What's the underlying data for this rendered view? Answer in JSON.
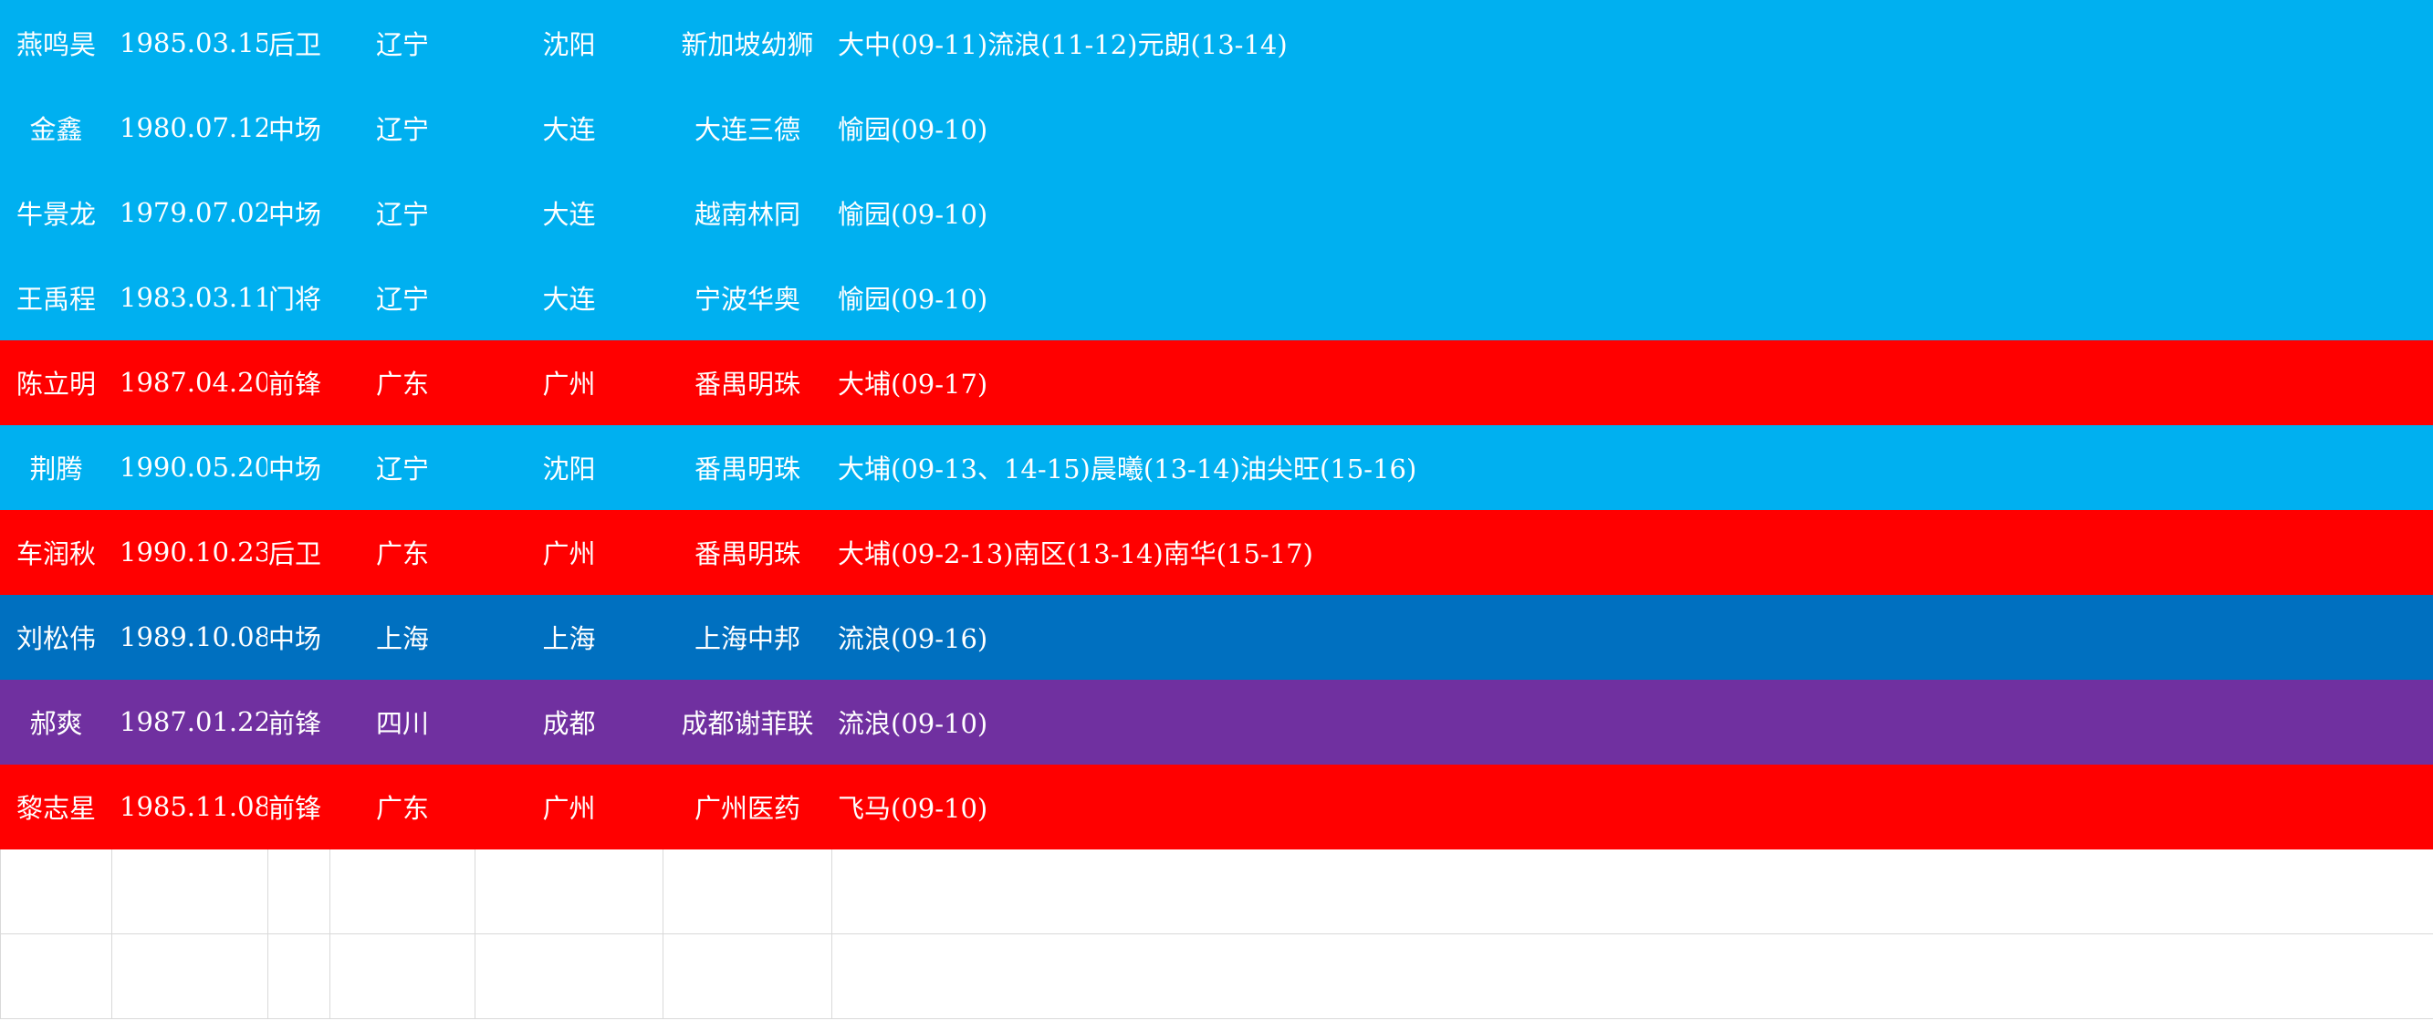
{
  "colors": {
    "liaoning": "#00b0f0",
    "guangdong": "#ff0000",
    "shanghai": "#0070c0",
    "sichuan": "#7030a0",
    "text": "#ffffff",
    "grid": "#d9d9d9"
  },
  "rows": [
    {
      "name": "燕鸣昊",
      "birth": "1985.03.15",
      "position": "后卫",
      "province": "辽宁",
      "city": "沈阳",
      "club": "新加坡幼狮",
      "history": "大中(09-11)流浪(11-12)元朗(13-14)",
      "color": "#00b0f0"
    },
    {
      "name": "金鑫",
      "birth": "1980.07.12",
      "position": "中场",
      "province": "辽宁",
      "city": "大连",
      "club": "大连三德",
      "history": "愉园(09-10)",
      "color": "#00b0f0"
    },
    {
      "name": "牛景龙",
      "birth": "1979.07.02",
      "position": "中场",
      "province": "辽宁",
      "city": "大连",
      "club": "越南林同",
      "history": "愉园(09-10)",
      "color": "#00b0f0"
    },
    {
      "name": "王禹程",
      "birth": "1983.03.11",
      "position": "门将",
      "province": "辽宁",
      "city": "大连",
      "club": "宁波华奥",
      "history": "愉园(09-10)",
      "color": "#00b0f0"
    },
    {
      "name": "陈立明",
      "birth": "1987.04.20",
      "position": "前锋",
      "province": "广东",
      "city": "广州",
      "club": "番禺明珠",
      "history": "大埔(09-17)",
      "color": "#ff0000"
    },
    {
      "name": "荆腾",
      "birth": "1990.05.20",
      "position": "中场",
      "province": "辽宁",
      "city": "沈阳",
      "club": "番禺明珠",
      "history": "大埔(09-13、14-15)晨曦(13-14)油尖旺(15-16)",
      "color": "#00b0f0"
    },
    {
      "name": "车润秋",
      "birth": "1990.10.23",
      "position": "后卫",
      "province": "广东",
      "city": "广州",
      "club": "番禺明珠",
      "history": "大埔(09-2-13)南区(13-14)南华(15-17)",
      "color": "#ff0000"
    },
    {
      "name": "刘松伟",
      "birth": "1989.10.08",
      "position": "中场",
      "province": "上海",
      "city": "上海",
      "club": "上海中邦",
      "history": "流浪(09-16)",
      "color": "#0070c0"
    },
    {
      "name": "郝爽",
      "birth": "1987.01.22",
      "position": "前锋",
      "province": "四川",
      "city": "成都",
      "club": "成都谢菲联",
      "history": "流浪(09-10)",
      "color": "#7030a0"
    },
    {
      "name": "黎志星",
      "birth": "1985.11.08",
      "position": "前锋",
      "province": "广东",
      "city": "广州",
      "club": "广州医药",
      "history": "飞马(09-10)",
      "color": "#ff0000"
    }
  ]
}
